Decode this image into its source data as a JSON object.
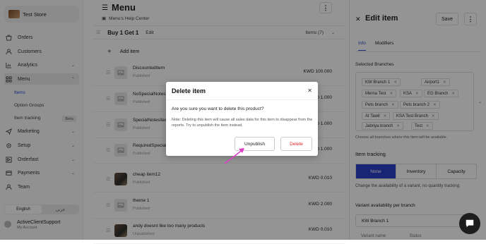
{
  "sidebar": {
    "store_name": "Test Store",
    "items": [
      {
        "label": "Orders",
        "icon": "orders-icon"
      },
      {
        "label": "Customers",
        "icon": "customers-icon"
      },
      {
        "label": "Analytics",
        "icon": "analytics-icon"
      },
      {
        "label": "Menu",
        "icon": "menu-icon"
      },
      {
        "label": "Marketing",
        "icon": "marketing-icon"
      },
      {
        "label": "Setup",
        "icon": "setup-icon"
      },
      {
        "label": "Orderfast",
        "icon": "orderfast-icon"
      },
      {
        "label": "Payments",
        "icon": "payments-icon"
      },
      {
        "label": "Team",
        "icon": "team-icon"
      }
    ],
    "sub_items": [
      "Items",
      "Option Groups",
      "Item tracking"
    ],
    "beta": "Beta",
    "lang_en": "English",
    "lang_ar": "عربي",
    "account_name": "ActiveClientSupport",
    "account_sub": "My Account"
  },
  "main": {
    "title": "Menu",
    "help": "Menu's Help Center",
    "category": {
      "name": "Buy 1 Get 1",
      "edit": "Edit",
      "count": "Items (7)"
    },
    "add_item": "Add item",
    "rows": [
      {
        "name": "DiscountedItem",
        "status": "Published",
        "price": "KWD 100.000"
      },
      {
        "name": "NoSpecialNotes",
        "status": "Published",
        "price": "KWD 1.000"
      },
      {
        "name": "SpecialNotesItem",
        "status": "Published",
        "price": "KWD 1.000"
      },
      {
        "name": "RequiredSpecialNotes",
        "status": "Published",
        "price": "KWD 1.000"
      },
      {
        "name": "cheap item12",
        "status": "Published",
        "price": "KWD 0.010"
      },
      {
        "name": "theme 1",
        "status": "Published",
        "price": "KWD 2.000"
      },
      {
        "name": "andy doesnt like too many products",
        "status": "Unpublished",
        "price": "KWD 0.010"
      }
    ]
  },
  "panel": {
    "title": "Edit item",
    "save": "Save",
    "tabs": [
      "Info",
      "Modifiers"
    ],
    "branches_label": "Selected Branches",
    "branches": [
      "KW Branch 1",
      "Airport1",
      "Merna Test",
      "KSA",
      "EG Branch",
      "Pets branch",
      "Pets branch 2",
      "At Tawil",
      "KSA Test Branch",
      "Jabriya branch",
      "Test"
    ],
    "branches_help": "Choose all branches where this item will be available.",
    "tracking_title": "Item tracking",
    "tracking_options": [
      "None",
      "Inventory",
      "Capacity"
    ],
    "tracking_desc": "Change the availability of a variant, no quantity tracking.",
    "availability_label": "Variant availability per branch",
    "availability_value": "KW Branch 1",
    "cols": [
      "Variant name",
      "Status"
    ]
  },
  "modal": {
    "title": "Delete item",
    "question": "Are you sure you want to delete this product?",
    "note": "Note: Deleting this item will cause all sales data for this item to disappear from the reports. Try to unpublish the item instead.",
    "unpublish": "Unpublish",
    "delete": "Delete"
  },
  "colors": {
    "accent": "#2a3fc9",
    "danger": "#dd2222",
    "arrow": "#e03cc4"
  }
}
